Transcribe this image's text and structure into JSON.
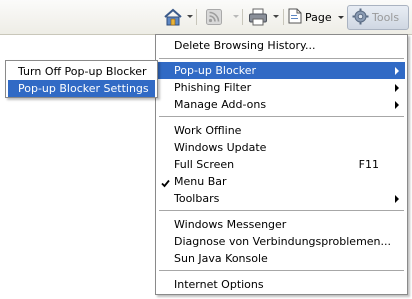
{
  "toolbar": {
    "icons": {
      "home": "home-icon",
      "feeds": "feeds-icon",
      "print": "print-icon",
      "page": "page-icon",
      "tools": "gear-icon"
    },
    "page_label": "Page",
    "tools_label": "Tools"
  },
  "menu": {
    "items": [
      {
        "label": "Delete Browsing History..."
      },
      {
        "label": "Pop-up Blocker",
        "submenu": true,
        "selected": true
      },
      {
        "label": "Phishing Filter",
        "submenu": true
      },
      {
        "label": "Manage Add-ons",
        "submenu": true
      },
      {
        "label": "Work Offline"
      },
      {
        "label": "Windows Update"
      },
      {
        "label": "Full Screen",
        "shortcut": "F11"
      },
      {
        "label": "Menu Bar",
        "checked": true
      },
      {
        "label": "Toolbars",
        "submenu": true
      },
      {
        "label": "Windows Messenger"
      },
      {
        "label": "Diagnose von Verbindungsproblemen..."
      },
      {
        "label": "Sun Java Konsole"
      },
      {
        "label": "Internet Options"
      }
    ]
  },
  "submenu": {
    "items": [
      {
        "label": "Turn Off Pop-up Blocker"
      },
      {
        "label": "Pop-up Blocker Settings",
        "selected": true
      }
    ]
  },
  "colors": {
    "highlight": "#316ac5",
    "menu_border": "#8a8a8a"
  }
}
